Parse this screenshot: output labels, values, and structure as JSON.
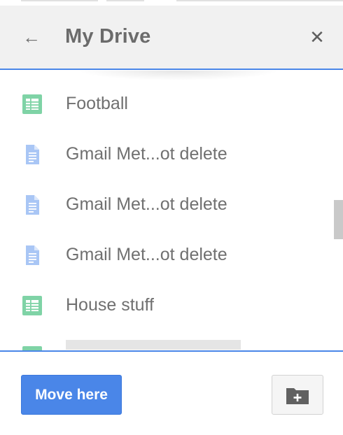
{
  "header": {
    "title": "My Drive",
    "back_icon": "arrow-left-icon",
    "close_icon": "close-icon"
  },
  "files": [
    {
      "name": "Football",
      "icon": "spreadsheet-icon",
      "color": "#32a852"
    },
    {
      "name": "Gmail Met...ot delete",
      "icon": "document-icon",
      "color": "#4a86e8"
    },
    {
      "name": "Gmail Met...ot delete",
      "icon": "document-icon",
      "color": "#4a86e8"
    },
    {
      "name": "Gmail Met...ot delete",
      "icon": "document-icon",
      "color": "#4a86e8"
    },
    {
      "name": "House stuff",
      "icon": "spreadsheet-icon",
      "color": "#32a852"
    }
  ],
  "footer": {
    "move_label": "Move here",
    "new_folder_icon": "new-folder-icon"
  },
  "colors": {
    "accent": "#4a86e8",
    "header_bg": "#f1f1f1"
  }
}
